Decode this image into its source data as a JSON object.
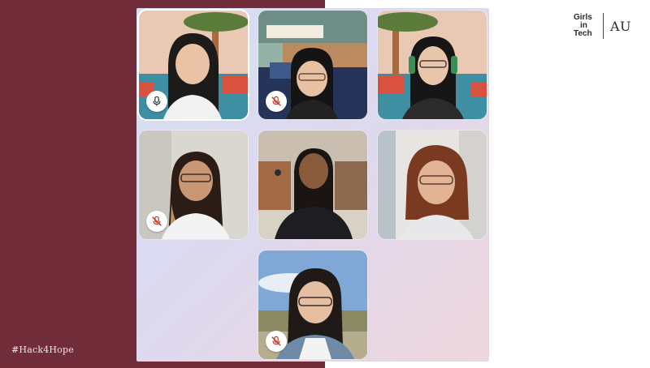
{
  "brand": {
    "girls_in_tech_lines": [
      "Girls",
      "in",
      "Tech"
    ],
    "au_label": "AU",
    "hashtag": "#Hack4Hope"
  },
  "colors": {
    "left_panel": "#722d3a",
    "mic_on": "#333333",
    "mic_muted": "#c0392b"
  },
  "participants": [
    {
      "row": 1,
      "col": 1,
      "mic": "on",
      "speaking": true
    },
    {
      "row": 1,
      "col": 2,
      "mic": "muted",
      "speaking": false
    },
    {
      "row": 1,
      "col": 3,
      "mic": "none",
      "speaking": false
    },
    {
      "row": 2,
      "col": 1,
      "mic": "muted",
      "speaking": false
    },
    {
      "row": 2,
      "col": 2,
      "mic": "none",
      "speaking": false
    },
    {
      "row": 2,
      "col": 3,
      "mic": "none",
      "speaking": false
    },
    {
      "row": 3,
      "col": 2,
      "mic": "muted",
      "speaking": false
    }
  ]
}
